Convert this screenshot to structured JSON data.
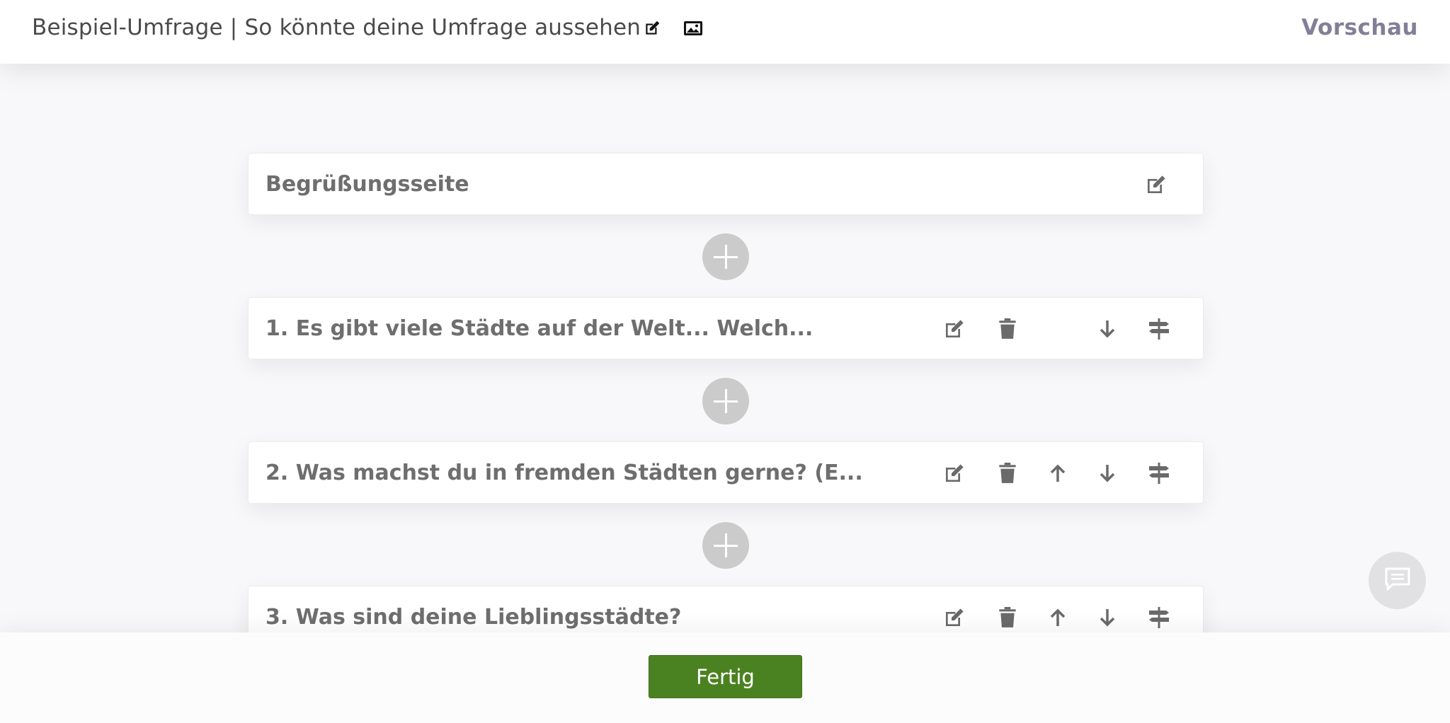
{
  "header": {
    "survey_title": "Beispiel-Umfrage | So könnte deine Umfrage aussehen",
    "edit_title_icon": "edit-icon",
    "image_icon": "image-icon",
    "preview_label": "Vorschau"
  },
  "cards": {
    "welcome": {
      "title": "Begrüßungsseite"
    },
    "q1": {
      "title": "1. Es gibt viele Städte auf der Welt... Welch..."
    },
    "q2": {
      "title": "2. Was machst du in fremden Städten gerne? (E..."
    },
    "q3": {
      "title": "3. Was sind deine Lieblingsstädte?"
    }
  },
  "icons": {
    "edit": "edit-icon",
    "delete": "trash-icon",
    "up": "arrow-up-icon",
    "down": "arrow-down-icon",
    "logic": "signpost-icon",
    "add": "plus-icon",
    "chat": "chat-icon"
  },
  "footer": {
    "done_label": "Fertig"
  },
  "colors": {
    "accent_green": "#4b8221",
    "preview_purple": "#837e98",
    "card_text": "#6e6e6e",
    "icon_gray": "#6a6a6a"
  }
}
